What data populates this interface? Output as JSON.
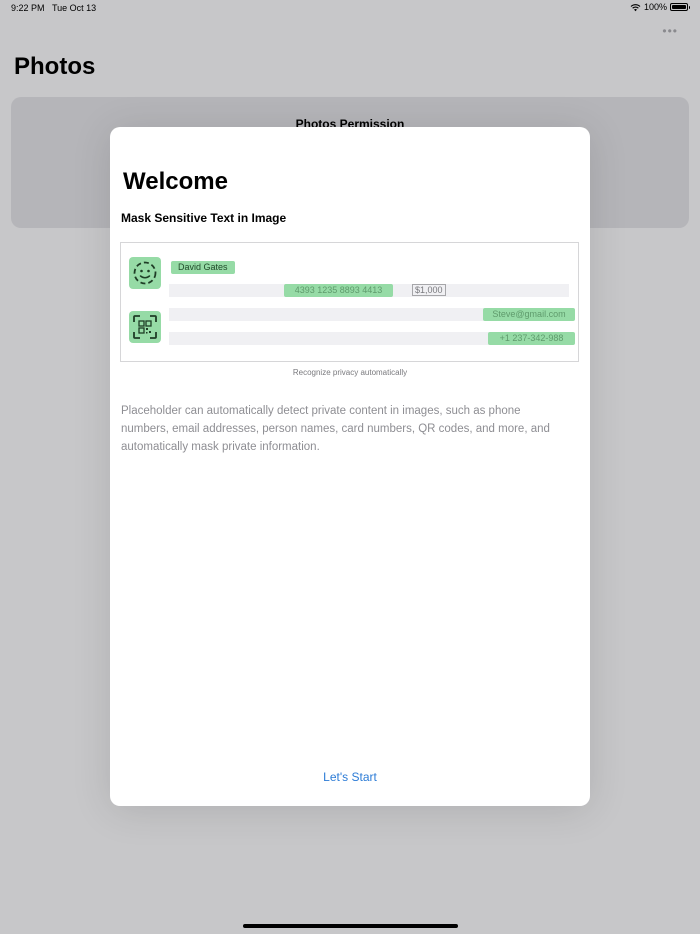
{
  "status_bar": {
    "time": "9:22 PM",
    "date": "Tue Oct 13",
    "battery": "100%"
  },
  "header": {
    "title": "Photos",
    "more_icon": "ellipsis-icon"
  },
  "background_card": {
    "title": "Photos Permission"
  },
  "modal": {
    "title": "Welcome",
    "subtitle": "Mask Sensitive Text in Image",
    "illustration": {
      "name_tag": "David Gates",
      "card_number": "4393 1235 8893 4413",
      "amount": "$1,000",
      "email": "Steve@gmail.com",
      "phone": "+1 237-342-988",
      "icons": [
        "face-icon",
        "qr-code-icon"
      ],
      "accent_color": "#96dba6"
    },
    "caption": "Recognize privacy automatically",
    "description": "Placeholder can automatically detect private content in images, such as phone numbers, email addresses, person names, card numbers, QR codes, and more, and automatically mask private information.",
    "start_button": "Let's Start",
    "link_color": "#2b7bd6"
  }
}
